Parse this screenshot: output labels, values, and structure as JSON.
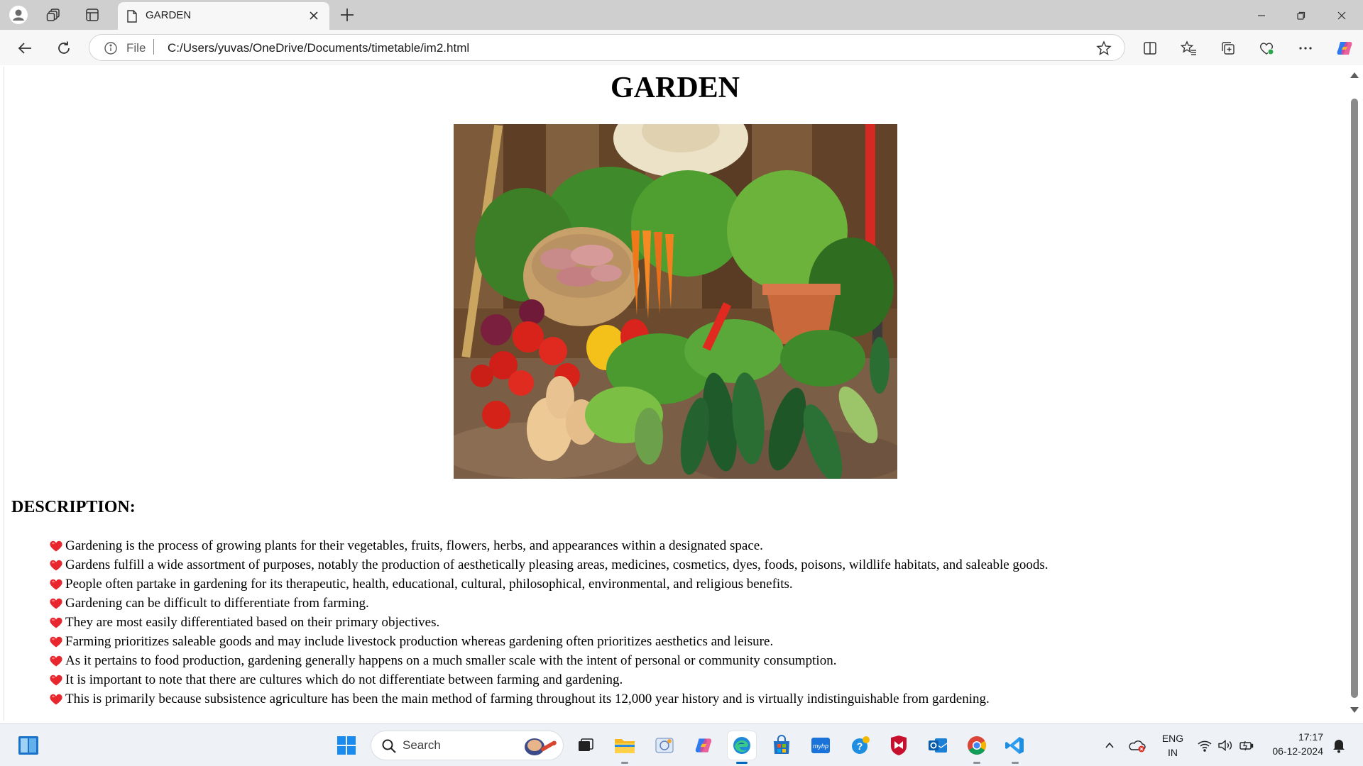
{
  "browser": {
    "tab_title": "GARDEN",
    "url_scheme_label": "File",
    "url": "C:/Users/yuvas/OneDrive/Documents/timetable/im2.html"
  },
  "page": {
    "title": "GARDEN",
    "image_alt": "vegetables in a garden",
    "description_heading": "DESCRIPTION:",
    "description_items": [
      "Gardening is the process of growing plants for their vegetables, fruits, flowers, herbs, and appearances within a designated space.",
      "Gardens fulfill a wide assortment of purposes, notably the production of aesthetically pleasing areas, medicines, cosmetics, dyes, foods, poisons, wildlife habitats, and saleable goods.",
      "People often partake in gardening for its therapeutic, health, educational, cultural, philosophical, environmental, and religious benefits.",
      "Gardening can be difficult to differentiate from farming.",
      "They are most easily differentiated based on their primary objectives.",
      "Farming prioritizes saleable goods and may include livestock production whereas gardening often prioritizes aesthetics and leisure.",
      "As it pertains to food production, gardening generally happens on a much smaller scale with the intent of personal or community consumption.",
      "It is important to note that there are cultures which do not differentiate between farming and gardening.",
      "This is primarily because subsistence agriculture has been the main method of farming throughout its 12,000 year history and is virtually indistinguishable from gardening."
    ],
    "bullet_icon": "heart-icon",
    "bullet_color": "#e8262d"
  },
  "taskbar": {
    "search_label": "Search",
    "language": "ENG",
    "region": "IN",
    "time": "17:17",
    "date": "06-12-2024"
  },
  "colors": {
    "tabbar_bg": "#cfcfcf",
    "chrome_bg": "#f7f7f7",
    "taskbar_bg": "#eef1f6",
    "accent": "#0067c0"
  }
}
